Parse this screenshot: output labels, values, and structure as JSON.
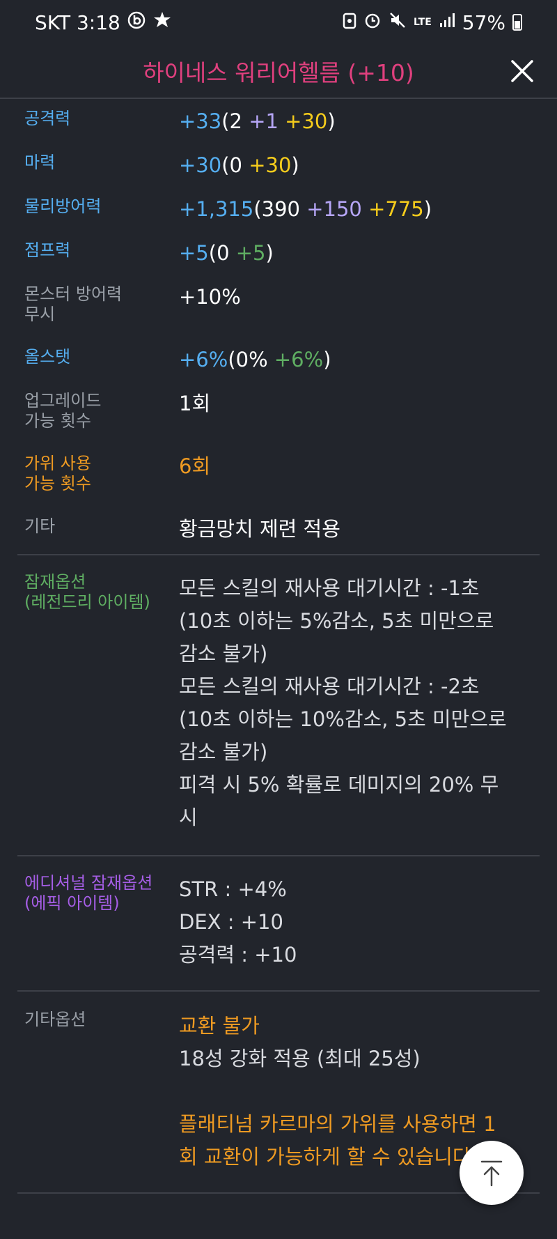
{
  "status_bar": {
    "carrier_time": "SKT 3:18",
    "app_icon": "b-circle-icon",
    "flower_icon": "flower-icon",
    "network": "LTE",
    "battery": "57%"
  },
  "header": {
    "title": "하이네스 워리어헬름 (+10)",
    "close_icon": "close-icon"
  },
  "stats": [
    {
      "label": "공격력",
      "total": "+33",
      "open": "(",
      "base": "2 ",
      "bonus": "+1 ",
      "enhance": "+30",
      "close": ")"
    },
    {
      "label": "마력",
      "total": "+30",
      "open": "(",
      "base": "0 ",
      "enhance": "+30",
      "close": ")"
    },
    {
      "label": "물리방어력",
      "total": "+1,315",
      "open": "(",
      "base": "390 ",
      "bonus": "+150 ",
      "enhance": "+775",
      "close": ")"
    },
    {
      "label": "점프력",
      "total": "+5",
      "open": "(",
      "base": "0 ",
      "extra": "+5",
      "close": ")"
    },
    {
      "label": "몬스터 방어력\n무시",
      "value": "+10%"
    },
    {
      "label": "올스탯",
      "total": "+6%",
      "open": "(",
      "base": "0% ",
      "extra": "+6%",
      "close": ")"
    },
    {
      "label": "업그레이드\n가능 횟수",
      "value": "1회"
    },
    {
      "label": "가위 사용\n가능 횟수",
      "value": "6회"
    },
    {
      "label": "기타",
      "value": "황금망치 제련 적용"
    }
  ],
  "potential": {
    "label": "잠재옵션\n(레전드리 아이템)",
    "lines": [
      "모든 스킬의 재사용 대기시간 : -1초",
      "(10초 이하는 5%감소, 5초 미만으로",
      "감소 불가)",
      "모든 스킬의 재사용 대기시간 : -2초",
      "(10초 이하는 10%감소, 5초 미만으로",
      "감소 불가)",
      "피격 시 5% 확률로 데미지의 20% 무",
      "시"
    ]
  },
  "additional": {
    "label": "에디셔널 잠재옵션\n(에픽 아이템)",
    "lines": [
      "STR : +4%",
      "DEX : +10",
      "공격력 : +10"
    ]
  },
  "etc_options": {
    "label": "기타옵션",
    "trade": "교환 불가",
    "star": "18성 강화 적용 (최대 25성)",
    "karma_1": "플래티넘 카르마의 가위를 사용하면 1",
    "karma_2": "회 교환이 가능하게 할 수 있습니다."
  },
  "scroll_top_icon": "arrow-up-icon",
  "colors": {
    "background": "#22252c",
    "title": "#e0407e",
    "blue": "#55aef0",
    "orange": "#ee9a22",
    "green": "#5fae62",
    "purple": "#a65ee6",
    "yellow": "#f5cc1c",
    "lavender": "#b6a6f7"
  }
}
